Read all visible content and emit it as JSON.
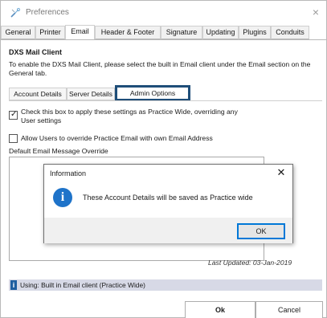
{
  "window": {
    "title": "Preferences",
    "close_glyph": "×",
    "icon": "preferences-icon"
  },
  "tabs": [
    {
      "label": "General",
      "active": false
    },
    {
      "label": "Printer",
      "active": false
    },
    {
      "label": "Email",
      "active": true
    },
    {
      "label": "Header & Footer",
      "active": false
    },
    {
      "label": "Signature",
      "active": false
    },
    {
      "label": "Updating",
      "active": false
    },
    {
      "label": "Plugins",
      "active": false
    },
    {
      "label": "Conduits",
      "active": false
    }
  ],
  "email": {
    "heading": "DXS Mail Client",
    "intro": "To enable the DXS Mail Client, please select the built in Email client under the Email section on the General tab.",
    "subtabs": [
      {
        "label": "Account Details",
        "active": false
      },
      {
        "label": "Server Details",
        "active": false
      },
      {
        "label": "Admin Options",
        "active": true
      }
    ],
    "apply_practice_wide": {
      "label": "Check this box to apply these settings as Practice Wide, overriding any User settings",
      "checked": true,
      "line1": "Check this box to apply these settings as Practice Wide, overriding any",
      "line2": "User settings"
    },
    "allow_override": {
      "label": "Allow Users to override Practice Email with own Email Address",
      "checked": false
    },
    "override_label": "Default Email Message Override",
    "override_value": "",
    "last_updated": "Last Updated: 03-Jan-2019"
  },
  "status": {
    "icon_glyph": "i",
    "text": "Using: Built in Email client (Practice Wide)"
  },
  "buttons": {
    "ok": "Ok",
    "cancel": "Cancel"
  },
  "dialog": {
    "title": "Information",
    "close_glyph": "✕",
    "icon_glyph": "i",
    "message": "These Account Details will be saved as Practice wide",
    "ok": "OK"
  },
  "colors": {
    "accent": "#1f4e79",
    "info_icon": "#1e73c9",
    "status_bar": "#d7d9e6"
  }
}
